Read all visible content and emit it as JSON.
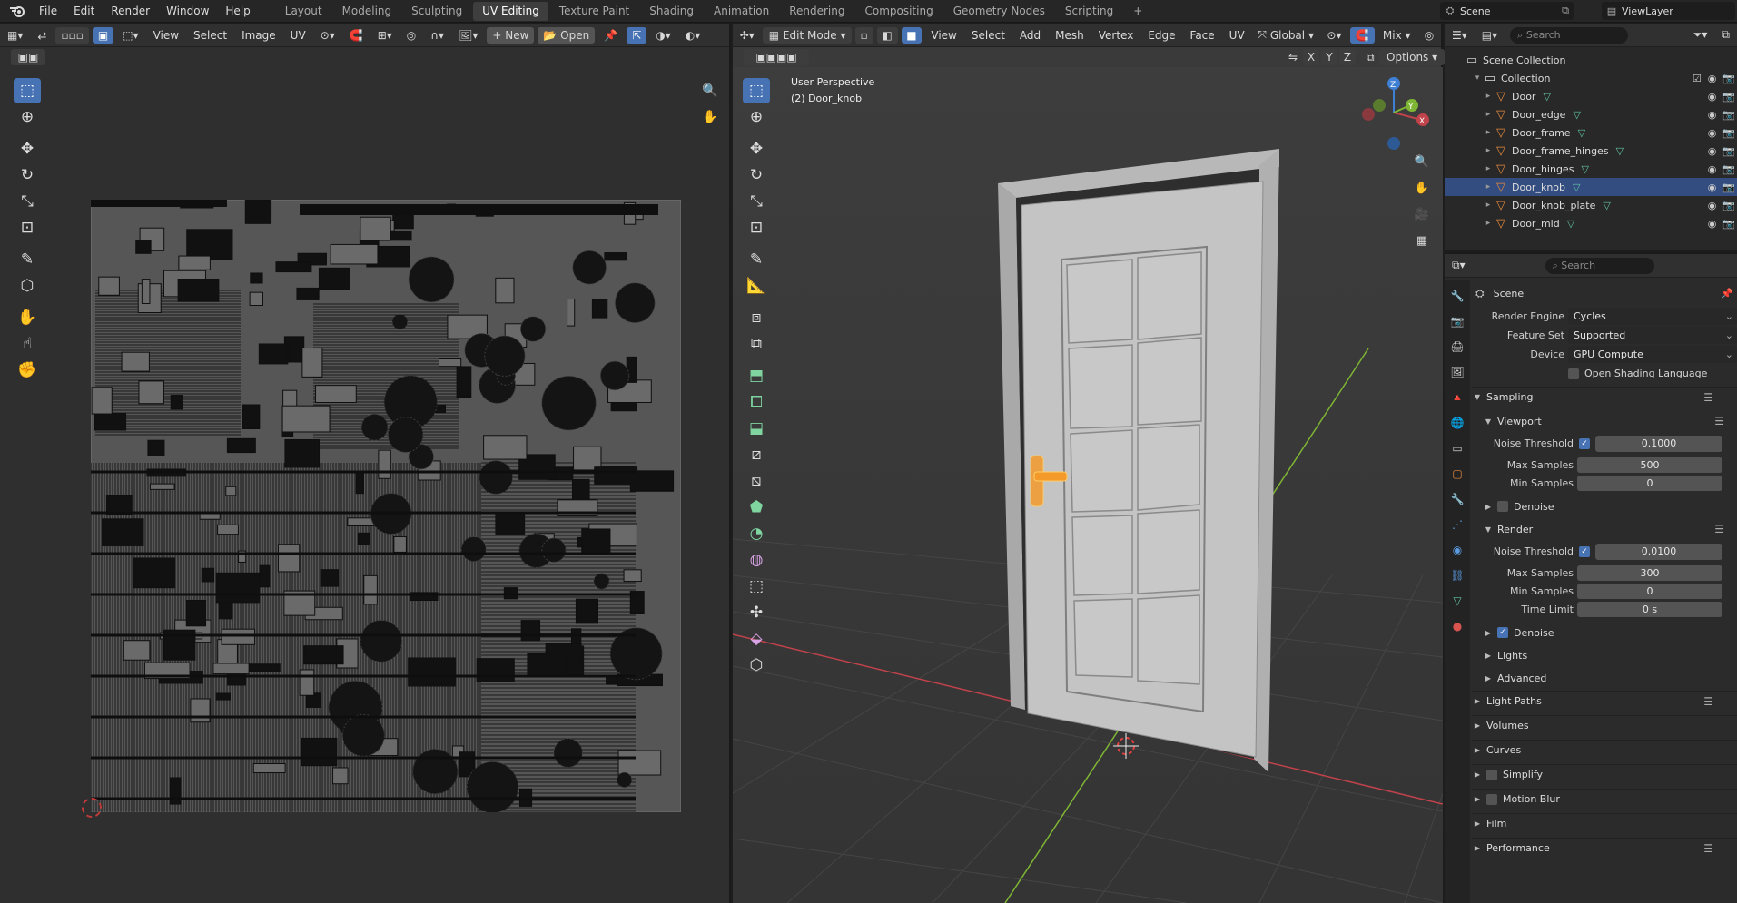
{
  "topbar": {
    "menus": [
      "File",
      "Edit",
      "Render",
      "Window",
      "Help"
    ],
    "workspaces": [
      "Layout",
      "Modeling",
      "Sculpting",
      "UV Editing",
      "Texture Paint",
      "Shading",
      "Animation",
      "Rendering",
      "Compositing",
      "Geometry Nodes",
      "Scripting"
    ],
    "active_workspace": "UV Editing",
    "add_workspace": "+",
    "scene_name": "Scene",
    "view_layer": "ViewLayer"
  },
  "uv_editor": {
    "menus": [
      "View",
      "Select",
      "Image",
      "UV"
    ],
    "new_label": "New",
    "open_label": "Open"
  },
  "viewport": {
    "mode": "Edit Mode",
    "menus": [
      "View",
      "Select",
      "Add",
      "Mesh",
      "Vertex",
      "Edge",
      "Face",
      "UV"
    ],
    "orientation": "Global",
    "shading": "Mix",
    "axis_x": "X",
    "axis_y": "Y",
    "axis_z": "Z",
    "options_label": "Options",
    "overlay_title": "User Perspective",
    "overlay_object": "(2) Door_knob",
    "colors": {
      "x_axis": "#c0424b",
      "y_axis": "#7fb534",
      "z_axis": "#3f7fd4",
      "selected": "#f39a2b"
    }
  },
  "outliner": {
    "search_placeholder": "Search",
    "root": "Scene Collection",
    "collection": "Collection",
    "items": [
      "Door",
      "Door_edge",
      "Door_frame",
      "Door_frame_hinges",
      "Door_hinges",
      "Door_knob",
      "Door_knob_plate",
      "Door_mid"
    ],
    "selected": "Door_knob"
  },
  "properties": {
    "search_placeholder": "Search",
    "scene_label": "Scene",
    "render_engine_label": "Render Engine",
    "render_engine": "Cycles",
    "feature_set_label": "Feature Set",
    "feature_set": "Supported",
    "device_label": "Device",
    "device": "GPU Compute",
    "osl_label": "Open Shading Language",
    "sampling": "Sampling",
    "viewport": "Viewport",
    "noise_threshold_label": "Noise Threshold",
    "viewport_noise_threshold": "0.1000",
    "max_samples_label": "Max Samples",
    "viewport_max_samples": "500",
    "min_samples_label": "Min Samples",
    "viewport_min_samples": "0",
    "denoise_label": "Denoise",
    "render": "Render",
    "render_noise_threshold": "0.0100",
    "render_max_samples": "300",
    "render_min_samples": "0",
    "time_limit_label": "Time Limit",
    "time_limit": "0 s",
    "lights": "Lights",
    "advanced": "Advanced",
    "light_paths": "Light Paths",
    "volumes": "Volumes",
    "curves": "Curves",
    "simplify": "Simplify",
    "motion_blur": "Motion Blur",
    "film": "Film",
    "performance": "Performance"
  }
}
